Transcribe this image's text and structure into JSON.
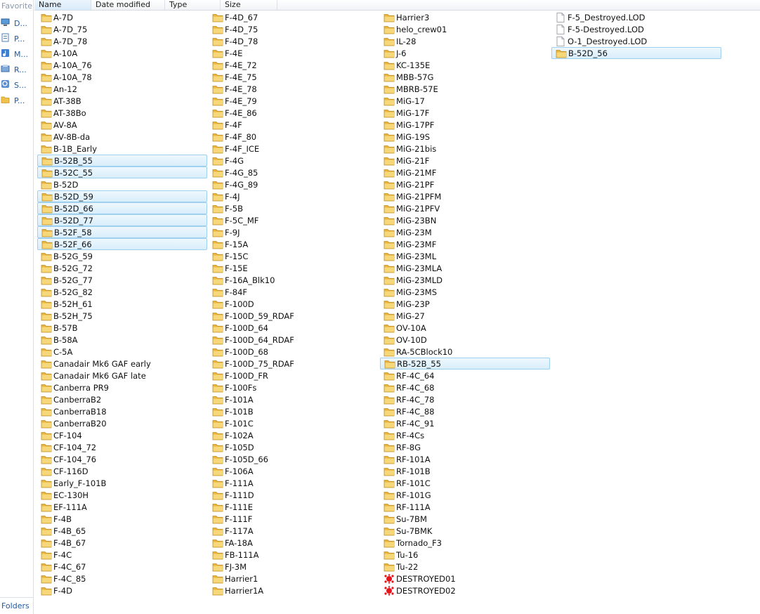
{
  "navigation": {
    "title": "Favorite l",
    "items": [
      {
        "label": "D...",
        "icon": "desktop-icon"
      },
      {
        "label": "P...",
        "icon": "document-icon"
      },
      {
        "label": "M...",
        "icon": "music-icon"
      },
      {
        "label": "R...",
        "icon": "recent-places-icon"
      },
      {
        "label": "S...",
        "icon": "searches-icon"
      },
      {
        "label": "P...",
        "icon": "folder-icon"
      }
    ],
    "footer": "Folders"
  },
  "columns": [
    "Name",
    "Date modified",
    "Type",
    "Size"
  ],
  "colors": {
    "folder": "#f0c24b",
    "selection_border": "#9fd0ee",
    "selection_fill": "#d8eefb",
    "nav_link": "#1e5aa8",
    "destroyed_icon": "#e8141b"
  },
  "files": [
    [
      {
        "name": "A-7D",
        "kind": "folder"
      },
      {
        "name": "A-7D_75",
        "kind": "folder"
      },
      {
        "name": "A-7D_78",
        "kind": "folder"
      },
      {
        "name": "A-10A",
        "kind": "folder"
      },
      {
        "name": "A-10A_76",
        "kind": "folder"
      },
      {
        "name": "A-10A_78",
        "kind": "folder"
      },
      {
        "name": "An-12",
        "kind": "folder"
      },
      {
        "name": "AT-38B",
        "kind": "folder"
      },
      {
        "name": "AT-38Bo",
        "kind": "folder"
      },
      {
        "name": "AV-8A",
        "kind": "folder"
      },
      {
        "name": "AV-8B-da",
        "kind": "folder"
      },
      {
        "name": "B-1B_Early",
        "kind": "folder"
      },
      {
        "name": "B-52B_55",
        "kind": "folder",
        "selected": true
      },
      {
        "name": "B-52C_55",
        "kind": "folder",
        "selected": true
      },
      {
        "name": "B-52D",
        "kind": "folder"
      },
      {
        "name": "B-52D_59",
        "kind": "folder",
        "selected": true
      },
      {
        "name": "B-52D_66",
        "kind": "folder",
        "selected": true
      },
      {
        "name": "B-52D_77",
        "kind": "folder",
        "selected": true
      },
      {
        "name": "B-52F_58",
        "kind": "folder",
        "selected": true
      },
      {
        "name": "B-52F_66",
        "kind": "folder",
        "selected": true
      },
      {
        "name": "B-52G_59",
        "kind": "folder"
      },
      {
        "name": "B-52G_72",
        "kind": "folder"
      },
      {
        "name": "B-52G_77",
        "kind": "folder"
      },
      {
        "name": "B-52G_82",
        "kind": "folder"
      },
      {
        "name": "B-52H_61",
        "kind": "folder"
      },
      {
        "name": "B-52H_75",
        "kind": "folder"
      },
      {
        "name": "B-57B",
        "kind": "folder"
      },
      {
        "name": "B-58A",
        "kind": "folder"
      },
      {
        "name": "C-5A",
        "kind": "folder"
      },
      {
        "name": "Canadair Mk6 GAF early",
        "kind": "folder"
      },
      {
        "name": "Canadair Mk6 GAF late",
        "kind": "folder"
      },
      {
        "name": "Canberra PR9",
        "kind": "folder"
      },
      {
        "name": "CanberraB2",
        "kind": "folder"
      },
      {
        "name": "CanberraB18",
        "kind": "folder"
      },
      {
        "name": "CanberraB20",
        "kind": "folder"
      },
      {
        "name": "CF-104",
        "kind": "folder"
      },
      {
        "name": "CF-104_72",
        "kind": "folder"
      },
      {
        "name": "CF-104_76",
        "kind": "folder"
      },
      {
        "name": "CF-116D",
        "kind": "folder"
      },
      {
        "name": "Early_F-101B",
        "kind": "folder"
      },
      {
        "name": "EC-130H",
        "kind": "folder"
      },
      {
        "name": "EF-111A",
        "kind": "folder"
      },
      {
        "name": "F-4B",
        "kind": "folder"
      },
      {
        "name": "F-4B_65",
        "kind": "folder"
      },
      {
        "name": "F-4B_67",
        "kind": "folder"
      },
      {
        "name": "F-4C",
        "kind": "folder"
      },
      {
        "name": "F-4C_67",
        "kind": "folder"
      },
      {
        "name": "F-4C_85",
        "kind": "folder"
      },
      {
        "name": "F-4D",
        "kind": "folder"
      }
    ],
    [
      {
        "name": "F-4D_67",
        "kind": "folder"
      },
      {
        "name": "F-4D_75",
        "kind": "folder"
      },
      {
        "name": "F-4D_78",
        "kind": "folder"
      },
      {
        "name": "F-4E",
        "kind": "folder"
      },
      {
        "name": "F-4E_72",
        "kind": "folder"
      },
      {
        "name": "F-4E_75",
        "kind": "folder"
      },
      {
        "name": "F-4E_78",
        "kind": "folder"
      },
      {
        "name": "F-4E_79",
        "kind": "folder"
      },
      {
        "name": "F-4E_86",
        "kind": "folder"
      },
      {
        "name": "F-4F",
        "kind": "folder"
      },
      {
        "name": "F-4F_80",
        "kind": "folder"
      },
      {
        "name": "F-4F_ICE",
        "kind": "folder"
      },
      {
        "name": "F-4G",
        "kind": "folder"
      },
      {
        "name": "F-4G_85",
        "kind": "folder"
      },
      {
        "name": "F-4G_89",
        "kind": "folder"
      },
      {
        "name": "F-4J",
        "kind": "folder"
      },
      {
        "name": "F-5B",
        "kind": "folder"
      },
      {
        "name": "F-5C_MF",
        "kind": "folder"
      },
      {
        "name": "F-9J",
        "kind": "folder"
      },
      {
        "name": "F-15A",
        "kind": "folder"
      },
      {
        "name": "F-15C",
        "kind": "folder"
      },
      {
        "name": "F-15E",
        "kind": "folder"
      },
      {
        "name": "F-16A_Blk10",
        "kind": "folder"
      },
      {
        "name": "F-84F",
        "kind": "folder"
      },
      {
        "name": "F-100D",
        "kind": "folder"
      },
      {
        "name": "F-100D_59_RDAF",
        "kind": "folder"
      },
      {
        "name": "F-100D_64",
        "kind": "folder"
      },
      {
        "name": "F-100D_64_RDAF",
        "kind": "folder"
      },
      {
        "name": "F-100D_68",
        "kind": "folder"
      },
      {
        "name": "F-100D_75_RDAF",
        "kind": "folder"
      },
      {
        "name": "F-100D_FR",
        "kind": "folder"
      },
      {
        "name": "F-100Fs",
        "kind": "folder"
      },
      {
        "name": "F-101A",
        "kind": "folder"
      },
      {
        "name": "F-101B",
        "kind": "folder"
      },
      {
        "name": "F-101C",
        "kind": "folder"
      },
      {
        "name": "F-102A",
        "kind": "folder"
      },
      {
        "name": "F-105D",
        "kind": "folder"
      },
      {
        "name": "F-105D_66",
        "kind": "folder"
      },
      {
        "name": "F-106A",
        "kind": "folder"
      },
      {
        "name": "F-111A",
        "kind": "folder"
      },
      {
        "name": "F-111D",
        "kind": "folder"
      },
      {
        "name": "F-111E",
        "kind": "folder"
      },
      {
        "name": "F-111F",
        "kind": "folder"
      },
      {
        "name": "F-117A",
        "kind": "folder"
      },
      {
        "name": "FA-18A",
        "kind": "folder"
      },
      {
        "name": "FB-111A",
        "kind": "folder"
      },
      {
        "name": "FJ-3M",
        "kind": "folder"
      },
      {
        "name": "Harrier1",
        "kind": "folder"
      },
      {
        "name": "Harrier1A",
        "kind": "folder"
      }
    ],
    [
      {
        "name": "Harrier3",
        "kind": "folder"
      },
      {
        "name": "helo_crew01",
        "kind": "folder"
      },
      {
        "name": "IL-28",
        "kind": "folder"
      },
      {
        "name": "J-6",
        "kind": "folder"
      },
      {
        "name": "KC-135E",
        "kind": "folder"
      },
      {
        "name": "MBB-57G",
        "kind": "folder"
      },
      {
        "name": "MBRB-57E",
        "kind": "folder"
      },
      {
        "name": "MiG-17",
        "kind": "folder"
      },
      {
        "name": "MiG-17F",
        "kind": "folder"
      },
      {
        "name": "MiG-17PF",
        "kind": "folder"
      },
      {
        "name": "MiG-19S",
        "kind": "folder"
      },
      {
        "name": "MiG-21bis",
        "kind": "folder"
      },
      {
        "name": "MiG-21F",
        "kind": "folder"
      },
      {
        "name": "MiG-21MF",
        "kind": "folder"
      },
      {
        "name": "MiG-21PF",
        "kind": "folder"
      },
      {
        "name": "MiG-21PFM",
        "kind": "folder"
      },
      {
        "name": "MiG-21PFV",
        "kind": "folder"
      },
      {
        "name": "MiG-23BN",
        "kind": "folder"
      },
      {
        "name": "MiG-23M",
        "kind": "folder"
      },
      {
        "name": "MiG-23MF",
        "kind": "folder"
      },
      {
        "name": "MiG-23ML",
        "kind": "folder"
      },
      {
        "name": "MiG-23MLA",
        "kind": "folder"
      },
      {
        "name": "MiG-23MLD",
        "kind": "folder"
      },
      {
        "name": "MiG-23MS",
        "kind": "folder"
      },
      {
        "name": "MiG-23P",
        "kind": "folder"
      },
      {
        "name": "MiG-27",
        "kind": "folder"
      },
      {
        "name": "OV-10A",
        "kind": "folder"
      },
      {
        "name": "OV-10D",
        "kind": "folder"
      },
      {
        "name": "RA-5CBlock10",
        "kind": "folder"
      },
      {
        "name": "RB-52B_55",
        "kind": "folder",
        "selected": true
      },
      {
        "name": "RF-4C_64",
        "kind": "folder"
      },
      {
        "name": "RF-4C_68",
        "kind": "folder"
      },
      {
        "name": "RF-4C_78",
        "kind": "folder"
      },
      {
        "name": "RF-4C_88",
        "kind": "folder"
      },
      {
        "name": "RF-4C_91",
        "kind": "folder"
      },
      {
        "name": "RF-4Cs",
        "kind": "folder"
      },
      {
        "name": "RF-8G",
        "kind": "folder"
      },
      {
        "name": "RF-101A",
        "kind": "folder"
      },
      {
        "name": "RF-101B",
        "kind": "folder"
      },
      {
        "name": "RF-101C",
        "kind": "folder"
      },
      {
        "name": "RF-101G",
        "kind": "folder"
      },
      {
        "name": "RF-111A",
        "kind": "folder"
      },
      {
        "name": "Su-7BM",
        "kind": "folder"
      },
      {
        "name": "Su-7BMK",
        "kind": "folder"
      },
      {
        "name": "Tornado_F3",
        "kind": "folder"
      },
      {
        "name": "Tu-16",
        "kind": "folder"
      },
      {
        "name": "Tu-22",
        "kind": "folder"
      },
      {
        "name": "DESTROYED01",
        "kind": "destroyed"
      },
      {
        "name": "DESTROYED02",
        "kind": "destroyed"
      }
    ],
    [
      {
        "name": "F-5_Destroyed.LOD",
        "kind": "file"
      },
      {
        "name": "F-5-Destroyed.LOD",
        "kind": "file"
      },
      {
        "name": "O-1_Destroyed.LOD",
        "kind": "file"
      },
      {
        "name": "B-52D_56",
        "kind": "folder",
        "selected": true
      }
    ]
  ]
}
